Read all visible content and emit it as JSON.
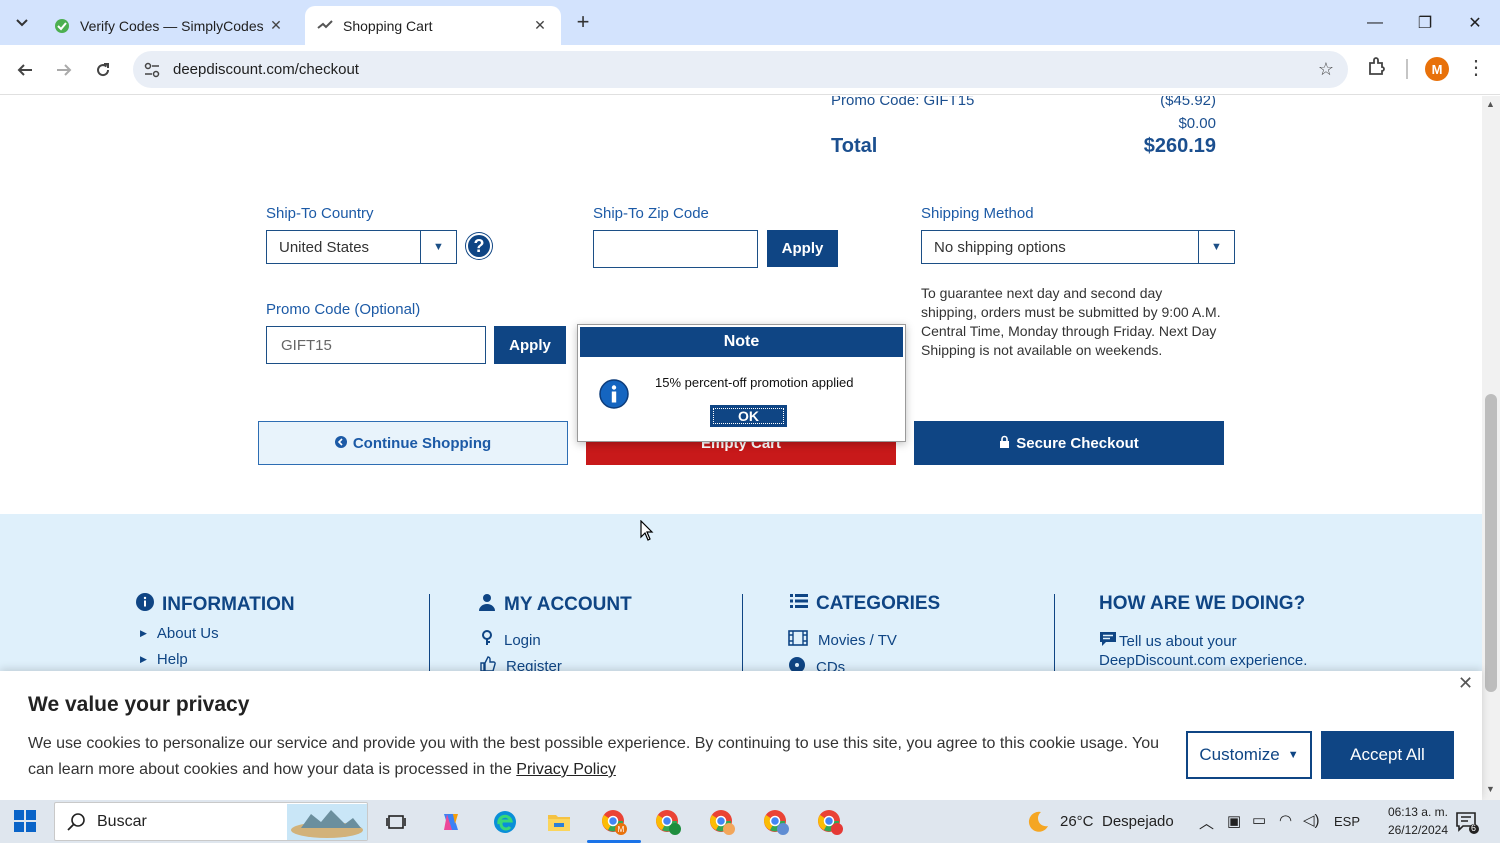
{
  "browser": {
    "tabs": [
      {
        "title": "Verify Codes — SimplyCodes",
        "active": false
      },
      {
        "title": "Shopping Cart",
        "active": true
      }
    ],
    "url": "deepdiscount.com/checkout",
    "profile_initial": "M"
  },
  "summary": {
    "promo_label": "Promo Code: GIFT15",
    "promo_value": "($45.92)",
    "extra_value": "$0.00",
    "total_label": "Total",
    "total_value": "$260.19"
  },
  "form": {
    "country_label": "Ship-To Country",
    "country_value": "United States",
    "zip_label": "Ship-To Zip Code",
    "zip_value": "",
    "zip_apply": "Apply",
    "shipping_label": "Shipping Method",
    "shipping_value": "No shipping options",
    "promo_label": "Promo Code (Optional)",
    "promo_value": "GIFT15",
    "promo_apply": "Apply",
    "shipping_note": "To guarantee next day and second day shipping, orders must be submitted by 9:00 A.M. Central Time, Monday through Friday. Next Day Shipping is not available on weekends."
  },
  "actions": {
    "continue": "Continue Shopping",
    "empty": "Empty Cart",
    "secure": "Secure Checkout"
  },
  "dialog": {
    "title": "Note",
    "message": "15% percent-off promotion applied",
    "ok": "OK"
  },
  "footer": {
    "information": {
      "heading": "INFORMATION",
      "links": [
        "About Us",
        "Help"
      ]
    },
    "account": {
      "heading": "MY ACCOUNT",
      "links": [
        "Login",
        "Register"
      ]
    },
    "categories": {
      "heading": "CATEGORIES",
      "links": [
        "Movies / TV",
        "CDs"
      ]
    },
    "feedback": {
      "heading": "HOW ARE WE DOING?",
      "line1": "Tell us about your",
      "line2": "DeepDiscount.com experience."
    }
  },
  "cookie": {
    "title": "We value your privacy",
    "text": "We use cookies to personalize our service and provide you with the best possible experience. By continuing to use this site, you agree to this cookie usage. You can learn more about cookies and how your data is processed in the",
    "link": "Privacy Policy",
    "customize": "Customize",
    "accept": "Accept All"
  },
  "taskbar": {
    "search_placeholder": "Buscar",
    "weather_temp": "26°C",
    "weather_desc": "Despejado",
    "language": "ESP",
    "time": "06:13 a. m.",
    "date": "26/12/2024",
    "notifications": "6"
  },
  "colors": {
    "brand_navy": "#0f4584",
    "empty_red": "#c8191a",
    "footer_bg": "#dff0fb"
  }
}
